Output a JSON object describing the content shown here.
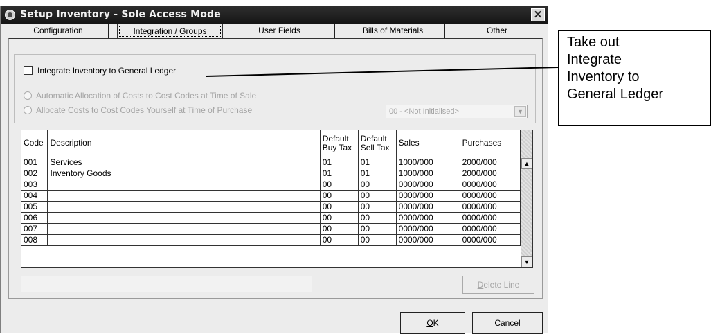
{
  "window": {
    "title": "Setup Inventory - Sole Access Mode",
    "close_symbol": "✕"
  },
  "tabs": [
    {
      "label": "Configuration",
      "active": false
    },
    {
      "label": "Integration / Groups",
      "active": true
    },
    {
      "label": "User Fields",
      "active": false
    },
    {
      "label": "Bills of Materials",
      "active": false
    },
    {
      "label": "Other",
      "active": false
    }
  ],
  "integration": {
    "checkbox_label": "Integrate Inventory to General Ledger",
    "checked": false,
    "radio_auto_label": "Automatic Allocation of Costs to Cost Codes at Time of Sale",
    "radio_manual_label": "Allocate Costs to Cost Codes Yourself at Time of Purchase",
    "dropdown_value": "00 - <Not Initialised>"
  },
  "grid": {
    "headers": {
      "code": "Code",
      "description": "Description",
      "buy_tax_1": "Default",
      "buy_tax_2": "Buy Tax",
      "sell_tax_1": "Default",
      "sell_tax_2": "Sell Tax",
      "sales": "Sales",
      "purchases": "Purchases"
    },
    "rows": [
      [
        "001",
        "Services",
        "01",
        "01",
        "1000/000",
        "2000/000"
      ],
      [
        "002",
        "Inventory Goods",
        "01",
        "01",
        "1000/000",
        "2000/000"
      ],
      [
        "003",
        "",
        "00",
        "00",
        "0000/000",
        "0000/000"
      ],
      [
        "004",
        "",
        "00",
        "00",
        "0000/000",
        "0000/000"
      ],
      [
        "005",
        "",
        "00",
        "00",
        "0000/000",
        "0000/000"
      ],
      [
        "006",
        "",
        "00",
        "00",
        "0000/000",
        "0000/000"
      ],
      [
        "007",
        "",
        "00",
        "00",
        "0000/000",
        "0000/000"
      ],
      [
        "008",
        "",
        "00",
        "00",
        "0000/000",
        "0000/000"
      ]
    ]
  },
  "buttons": {
    "delete_prefix": "D",
    "delete_rest": "elete Line",
    "ok_prefix": "O",
    "ok_rest": "K",
    "cancel": "Cancel"
  },
  "callout": {
    "lines": [
      "Take out",
      "Integrate",
      "Inventory to",
      "General Ledger"
    ]
  },
  "icons": {
    "window_icon": "setup-icon",
    "scroll_up": "▲",
    "scroll_down": "▼",
    "dropdown_arrow": "▼"
  }
}
